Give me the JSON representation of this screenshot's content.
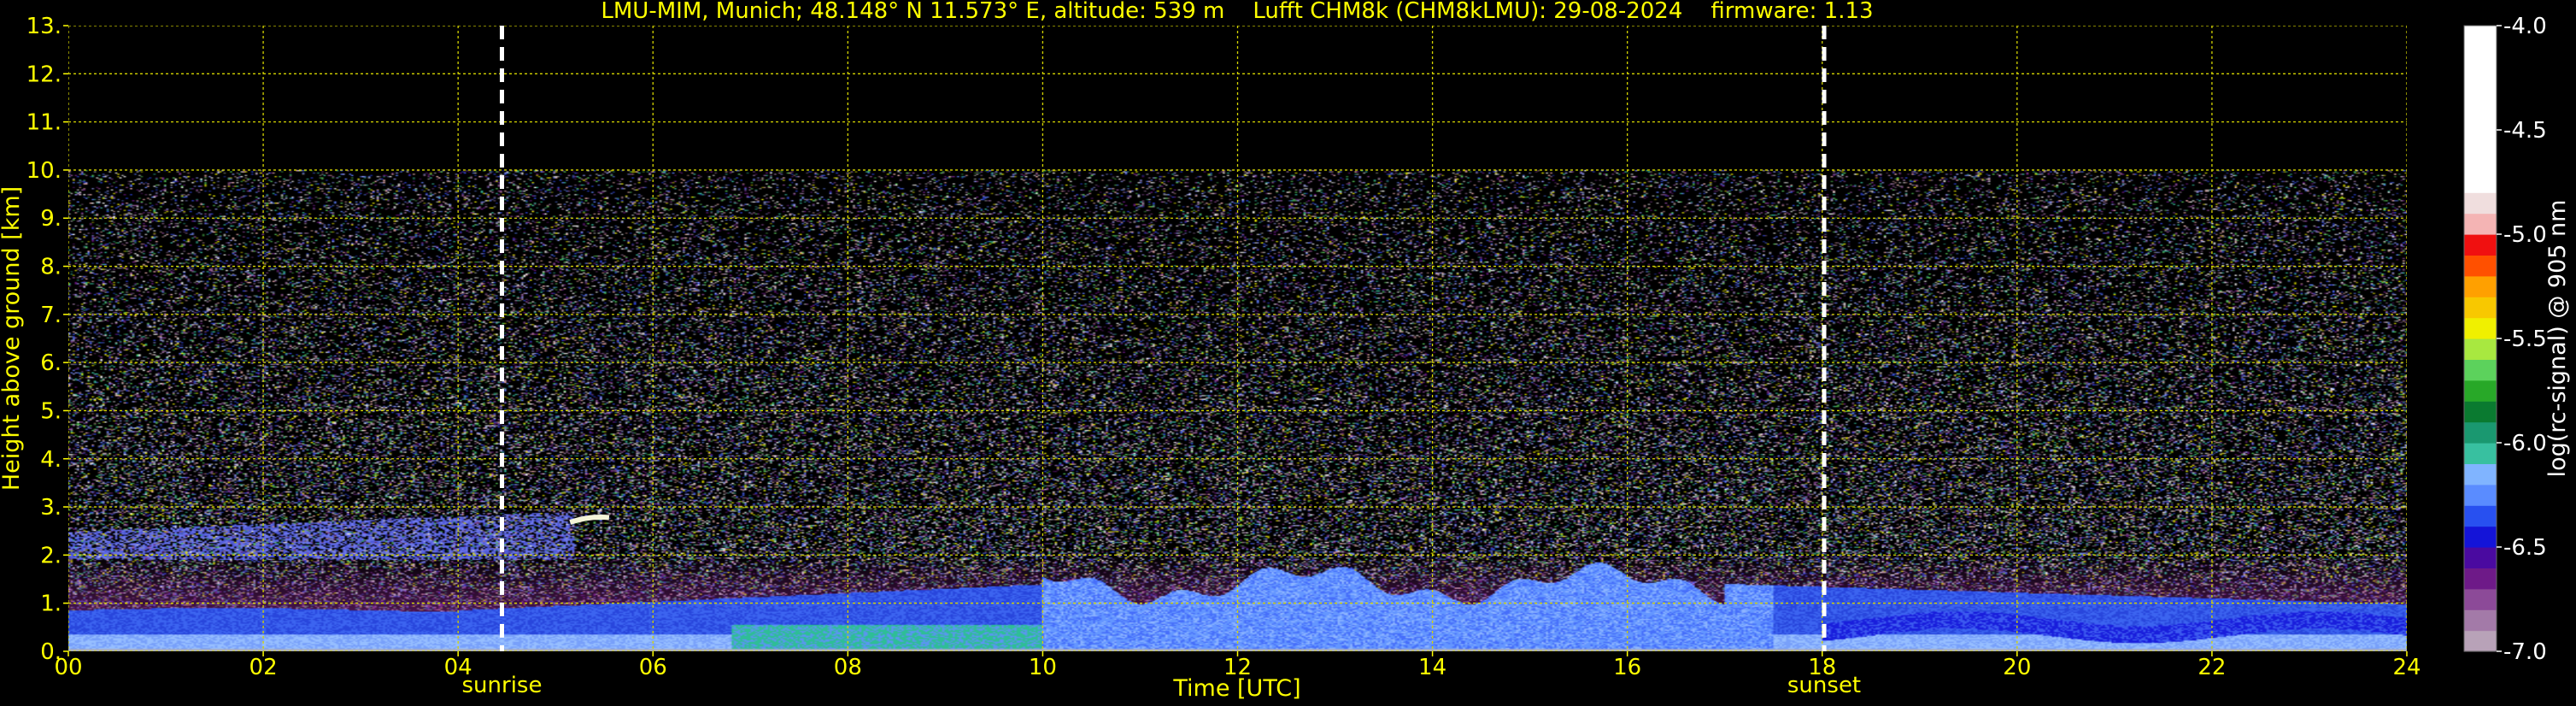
{
  "chart_data": {
    "type": "heatmap",
    "title": "LMU-MIM, Munich; 48.148° N 11.573° E, altitude: 539 m    Lufft CHM8k (CHM8kLMU): 29-08-2024    firmware: 1.13",
    "xlabel": "Time [UTC]",
    "ylabel": "Height above ground [km]",
    "xlim": [
      0,
      24
    ],
    "ylim": [
      0,
      13
    ],
    "x_ticks": [
      "00",
      "02",
      "04",
      "06",
      "08",
      "10",
      "12",
      "14",
      "16",
      "18",
      "20",
      "22",
      "24"
    ],
    "y_ticks": [
      "0.",
      "1.",
      "2.",
      "3.",
      "4.",
      "5.",
      "6.",
      "7.",
      "8.",
      "9.",
      "10.",
      "11.",
      "12.",
      "13."
    ],
    "grid": true,
    "grid_color": "#d4d400",
    "text_color": "#ffff00",
    "data_top_km": 10,
    "markers": [
      {
        "time": 4.45,
        "label": "sunrise"
      },
      {
        "time": 18.02,
        "label": "sunset"
      }
    ],
    "colorbar": {
      "label": "log(rc-signal) @ 905 nm",
      "range": [
        -7.0,
        -4.0
      ],
      "ticks": [
        "-4.0",
        "-4.5",
        "-5.0",
        "-5.5",
        "-6.0",
        "-6.5",
        "-7.0"
      ],
      "segments": [
        {
          "from": -7.0,
          "to": -6.9,
          "color": "#b8a2b8"
        },
        {
          "from": -6.9,
          "to": -6.8,
          "color": "#a37aa8"
        },
        {
          "from": -6.8,
          "to": -6.7,
          "color": "#8c4a98"
        },
        {
          "from": -6.7,
          "to": -6.6,
          "color": "#6e1a88"
        },
        {
          "from": -6.6,
          "to": -6.5,
          "color": "#4a0aa0"
        },
        {
          "from": -6.5,
          "to": -6.4,
          "color": "#1414d8"
        },
        {
          "from": -6.4,
          "to": -6.3,
          "color": "#2850f0"
        },
        {
          "from": -6.3,
          "to": -6.2,
          "color": "#5a8cff"
        },
        {
          "from": -6.2,
          "to": -6.1,
          "color": "#80b4ff"
        },
        {
          "from": -6.1,
          "to": -6.0,
          "color": "#38c0a0"
        },
        {
          "from": -6.0,
          "to": -5.9,
          "color": "#1a9870"
        },
        {
          "from": -5.9,
          "to": -5.8,
          "color": "#0a7a30"
        },
        {
          "from": -5.8,
          "to": -5.7,
          "color": "#28a828"
        },
        {
          "from": -5.7,
          "to": -5.6,
          "color": "#5cd25c"
        },
        {
          "from": -5.6,
          "to": -5.5,
          "color": "#a8e840"
        },
        {
          "from": -5.5,
          "to": -5.4,
          "color": "#f0f000"
        },
        {
          "from": -5.4,
          "to": -5.3,
          "color": "#f8c800"
        },
        {
          "from": -5.3,
          "to": -5.2,
          "color": "#ffa000"
        },
        {
          "from": -5.2,
          "to": -5.1,
          "color": "#ff5000"
        },
        {
          "from": -5.1,
          "to": -5.0,
          "color": "#f01010"
        },
        {
          "from": -5.0,
          "to": -4.9,
          "color": "#f4b4b4"
        },
        {
          "from": -4.9,
          "to": -4.8,
          "color": "#f0dede"
        },
        {
          "from": -4.8,
          "to": -4.0,
          "color": "#ffffff"
        }
      ]
    }
  }
}
